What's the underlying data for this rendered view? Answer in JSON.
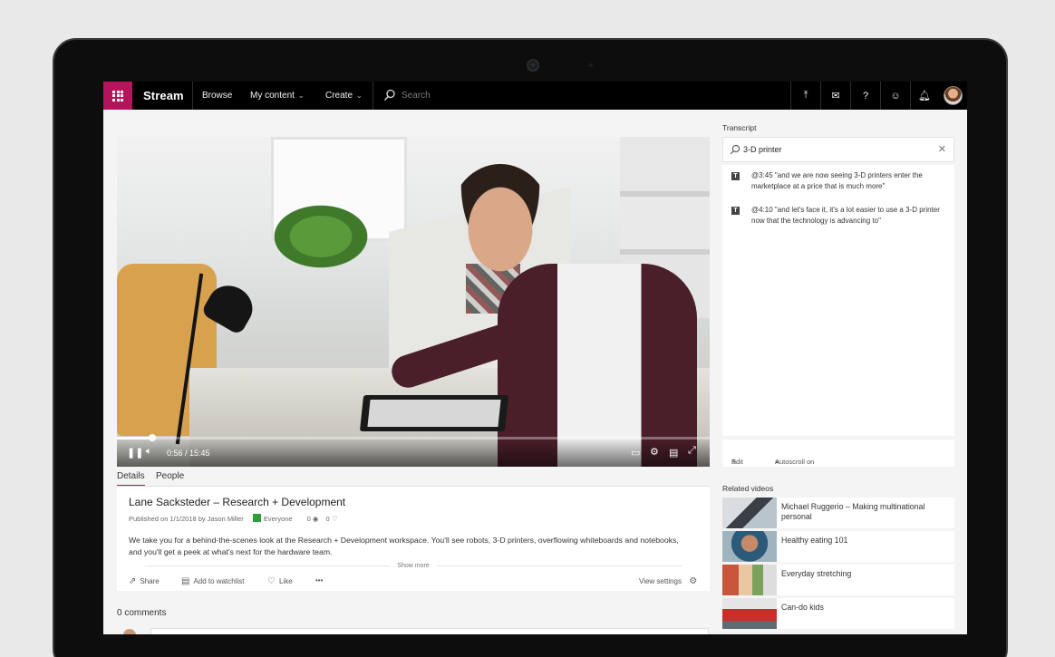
{
  "app": {
    "name": "Stream",
    "accent_color": "#b4145a"
  },
  "nav": {
    "browse": "Browse",
    "my_content": "My content",
    "create": "Create",
    "search_placeholder": "Search",
    "right_icons": [
      "upload-icon",
      "mail-icon",
      "help-icon",
      "smiley-icon",
      "bell-icon",
      "avatar"
    ]
  },
  "player": {
    "time": "0:56 / 15:45",
    "progress": 0.06
  },
  "tabs": {
    "details": "Details",
    "people": "People"
  },
  "video": {
    "title": "Lane Sacksteder – Research + Development",
    "published": "Published on 1/1/2018 by Jason Miller",
    "audience": "Everyone",
    "views": "0",
    "likes": "0",
    "description": "We take you for a behind-the-scenes look at the Research + Development workspace. You'll see robots, 3-D printers, overflowing whiteboards and notebooks, and you'll get a peek at what's next for the hardware team.",
    "show_more": "Show more"
  },
  "actions": {
    "share": "Share",
    "watchlist": "Add to watchlist",
    "like": "Like",
    "more": "•••",
    "view_settings": "View settings"
  },
  "comments": {
    "count_label": "0 comments"
  },
  "transcript": {
    "label": "Transcript",
    "search_value": "3-D printer",
    "results": [
      {
        "text": "@3:45 \"and we are now seeing 3-D printers enter the marketplace at a price that is much more\""
      },
      {
        "text": "@4:10 \"and let's face it, it's a lot easier to use a 3-D printer now that the technology is advancing to\""
      }
    ],
    "edit": "Edit",
    "autoscroll": "Autoscroll on"
  },
  "related": {
    "label": "Related videos",
    "items": [
      {
        "title": "Michael Ruggerio – Making multinational personal"
      },
      {
        "title": "Healthy eating 101"
      },
      {
        "title": "Everyday stretching"
      },
      {
        "title": "Can-do kids"
      }
    ]
  }
}
